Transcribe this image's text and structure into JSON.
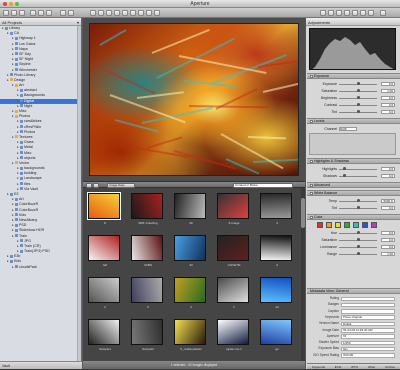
{
  "window": {
    "title": "Aperture"
  },
  "library": {
    "header": "All Projects",
    "header_arrow": "▾",
    "items": [
      {
        "label": "Library",
        "indent": 0,
        "color": "#8a8a8a"
      },
      {
        "label": "CA",
        "indent": 1,
        "color": "#6d8fc7"
      },
      {
        "label": "Highway 1",
        "indent": 2,
        "color": "#6d8fc7"
      },
      {
        "label": "Los Gatos",
        "indent": 2,
        "color": "#6d8fc7"
      },
      {
        "label": "Napa",
        "indent": 2,
        "color": "#6d8fc7"
      },
      {
        "label": "SF Day",
        "indent": 2,
        "color": "#6d8fc7"
      },
      {
        "label": "SF Night",
        "indent": 2,
        "color": "#6d8fc7"
      },
      {
        "label": "Skyline",
        "indent": 2,
        "color": "#6d8fc7"
      },
      {
        "label": "Winchester",
        "indent": 2,
        "color": "#6d8fc7"
      },
      {
        "label": "Photo Library",
        "indent": 1,
        "color": "#6d8fc7"
      },
      {
        "label": "Design",
        "indent": 1,
        "color": "#d8b24a"
      },
      {
        "label": "Art",
        "indent": 2,
        "color": "#d8b24a"
      },
      {
        "label": "abstract",
        "indent": 3,
        "color": "#6d8fc7"
      },
      {
        "label": "Backgrounds",
        "indent": 3,
        "color": "#6d8fc7"
      },
      {
        "label": "Digital",
        "indent": 3,
        "color": "#6d8fc7",
        "selected": true
      },
      {
        "label": "Night",
        "indent": 3,
        "color": "#6d8fc7"
      },
      {
        "label": "Misc",
        "indent": 2,
        "color": "#d8b24a"
      },
      {
        "label": "Photos",
        "indent": 2,
        "color": "#d8b24a"
      },
      {
        "label": "cars&bikes",
        "indent": 3,
        "color": "#6d8fc7"
      },
      {
        "label": "cResPhilio",
        "indent": 3,
        "color": "#6d8fc7"
      },
      {
        "label": "Photos",
        "indent": 3,
        "color": "#6d8fc7"
      },
      {
        "label": "Textures",
        "indent": 2,
        "color": "#d8b24a"
      },
      {
        "label": "Grass",
        "indent": 3,
        "color": "#6d8fc7"
      },
      {
        "label": "Metal",
        "indent": 3,
        "color": "#6d8fc7"
      },
      {
        "label": "Misc",
        "indent": 3,
        "color": "#6d8fc7"
      },
      {
        "label": "objects",
        "indent": 3,
        "color": "#6d8fc7"
      },
      {
        "label": "Vector",
        "indent": 2,
        "color": "#d8b24a"
      },
      {
        "label": "backgrounds",
        "indent": 3,
        "color": "#6d8fc7"
      },
      {
        "label": "building",
        "indent": 3,
        "color": "#6d8fc7"
      },
      {
        "label": "Landscape",
        "indent": 3,
        "color": "#6d8fc7"
      },
      {
        "label": "tiles",
        "indent": 3,
        "color": "#6d8fc7"
      },
      {
        "label": "Via Vault",
        "indent": 3,
        "color": "#6d8fc7"
      },
      {
        "label": "E3",
        "indent": 1,
        "color": "#6d8fc7"
      },
      {
        "label": "Art",
        "indent": 2,
        "color": "#6d8fc7"
      },
      {
        "label": "ColorBuzzR",
        "indent": 2,
        "color": "#6d8fc7"
      },
      {
        "label": "ColorBuzzR",
        "indent": 2,
        "color": "#6d8fc7"
      },
      {
        "label": "Kids",
        "indent": 2,
        "color": "#6d8fc7"
      },
      {
        "label": "NewAlbany",
        "indent": 2,
        "color": "#6d8fc7"
      },
      {
        "label": "PSD",
        "indent": 2,
        "color": "#6d8fc7"
      },
      {
        "label": "Slideshow HDR",
        "indent": 2,
        "color": "#6d8fc7"
      },
      {
        "label": "Train",
        "indent": 2,
        "color": "#6d8fc7"
      },
      {
        "label": "JPG",
        "indent": 3,
        "color": "#6d8fc7"
      },
      {
        "label": "Train (CR)",
        "indent": 3,
        "color": "#6d8fc7"
      },
      {
        "label": "Train(JPG) PSD",
        "indent": 3,
        "color": "#6d8fc7"
      },
      {
        "label": "E3b",
        "indent": 1,
        "color": "#6d8fc7"
      },
      {
        "label": "Kids",
        "indent": 1,
        "color": "#6d8fc7"
      },
      {
        "label": "cloudsPark",
        "indent": 2,
        "color": "#6d8fc7"
      }
    ],
    "footer_label": "Vault"
  },
  "browser_bar": {
    "sort_label": "Image Date",
    "search_placeholder": "Unrated or Better"
  },
  "thumbnails": [
    {
      "cap": "8",
      "c1": "#e85a12",
      "c2": "#f5d23a",
      "selected": true
    },
    {
      "cap": "SMF Crashing",
      "c1": "#1a1a1a",
      "c2": "#aa2020"
    },
    {
      "cap": "29",
      "c1": "#222",
      "c2": "#bbb"
    },
    {
      "cap": "5-image",
      "c1": "#333",
      "c2": "#e04040"
    },
    {
      "cap": "4",
      "c1": "#2a2a2a",
      "c2": "#999"
    },
    {
      "cap": "fall",
      "c1": "#b02020",
      "c2": "#f5f5f5"
    },
    {
      "cap": "CFBS",
      "c1": "#5a1010",
      "c2": "#e8e8e8"
    },
    {
      "cap": "33",
      "c1": "#103060",
      "c2": "#4aa0e0"
    },
    {
      "cap": "COVETM",
      "c1": "#602020",
      "c2": "#222"
    },
    {
      "cap": "d",
      "c1": "#f4f4f4",
      "c2": "#111"
    },
    {
      "cap": "2",
      "c1": "#555",
      "c2": "#ccc"
    },
    {
      "cap": "3",
      "c1": "#404060",
      "c2": "#aaa"
    },
    {
      "cap": "4",
      "c1": "#c0a020",
      "c2": "#2a6a20"
    },
    {
      "cap": "h",
      "c1": "#4a4a4a",
      "c2": "#e0e0e0"
    },
    {
      "cap": "14",
      "c1": "#1050c0",
      "c2": "#60c0ff"
    },
    {
      "cap": "Sample1",
      "c1": "#f0f0f0",
      "c2": "#222"
    },
    {
      "cap": "Sample2",
      "c1": "#303030",
      "c2": "#777"
    },
    {
      "cap": "5_nvidia-plaster",
      "c1": "#2a1a0a",
      "c2": "#f4e050"
    },
    {
      "cap": "jupiter-inv-1",
      "c1": "#101a40",
      "c2": "#fff"
    },
    {
      "cap": "gs",
      "c1": "#2040a0",
      "c2": "#80c8ff"
    }
  ],
  "status_text": "1 selected - 32 images displayed",
  "inspector": {
    "header": "Adjustments",
    "exposure_label": "Exposure",
    "exposure_rows": [
      {
        "label": "Exposure",
        "value": "0.0",
        "pos": 0.5
      },
      {
        "label": "Saturation",
        "value": "1.00",
        "pos": 0.5
      },
      {
        "label": "Brightness",
        "value": "0.0",
        "pos": 0.5
      },
      {
        "label": "Contrast",
        "value": "0.0",
        "pos": 0.5
      },
      {
        "label": "Tint",
        "value": "0.0",
        "pos": 0.5
      }
    ],
    "levels_label": "Levels",
    "channel_label": "Channel",
    "channel_value": "RGB",
    "hs_label": "Highlights & Shadows",
    "hs_rows": [
      {
        "label": "Highlights",
        "value": "0.0",
        "pos": 0.1
      },
      {
        "label": "Shadows",
        "value": "0.0",
        "pos": 0.1
      }
    ],
    "advanced_label": "Advanced",
    "wb_label": "White Balance",
    "wb_rows": [
      {
        "label": "Temp",
        "value": "5000 K",
        "pos": 0.5
      },
      {
        "label": "Tint",
        "value": "0.0",
        "pos": 0.5
      }
    ],
    "color_label": "Color",
    "swatch_colors": [
      "#e23030",
      "#f0a020",
      "#e8e020",
      "#30b030",
      "#30c0c0",
      "#3050e0",
      "#b040c0"
    ],
    "color_rows": [
      {
        "label": "Hue",
        "value": "0.0",
        "pos": 0.5
      },
      {
        "label": "Saturation",
        "value": "0.0",
        "pos": 0.5
      },
      {
        "label": "Luminance",
        "value": "0.0",
        "pos": 0.5
      },
      {
        "label": "Range",
        "value": "1.00",
        "pos": 0.5
      }
    ],
    "metadata_header": "Metadata View: General",
    "meta_rows": [
      {
        "k": "Rating",
        "v": ""
      },
      {
        "k": "Badges",
        "v": ""
      },
      {
        "k": "Caption",
        "v": ""
      },
      {
        "k": "Keywords",
        "v": "Photo Original"
      },
      {
        "k": "Version Name",
        "v": "Digital"
      },
      {
        "k": "Image Date",
        "v": "03-24-09 11:29:40 AM"
      },
      {
        "k": "Aperture",
        "v": "f/4"
      },
      {
        "k": "Shutter Speed",
        "v": "1/250"
      },
      {
        "k": "Exposure Bias",
        "v": "0ev"
      },
      {
        "k": "ISO Speed Rating",
        "v": "ISO100"
      }
    ],
    "meta_tabs": [
      "Keywords",
      "EXIF",
      "IPTC",
      "Other",
      "Archive"
    ]
  }
}
